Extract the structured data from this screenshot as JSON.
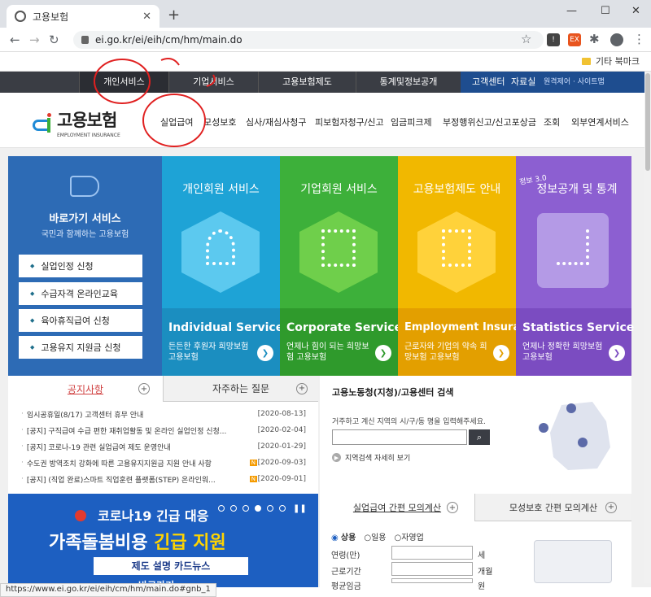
{
  "browser": {
    "tab_title": "고용보험",
    "url": "ei.go.kr/ei/eih/cm/hm/main.do",
    "bookmark_folder": "기타 북마크",
    "status_url": "https://www.ei.go.kr/ei/eih/cm/hm/main.do#gnb_1"
  },
  "gnb": {
    "items": [
      "개인서비스",
      "기업서비스",
      "고용보험제도",
      "통계및정보공개"
    ],
    "center": "고객센터",
    "data": "자료실",
    "links": "원격제어 · 사이트맵"
  },
  "logo": {
    "ko": "고용보험",
    "en": "EMPLOYMENT INSURANCE"
  },
  "lnb": {
    "items": [
      "실업급여",
      "모성보호",
      "심사/재심사청구",
      "피보험자청구/신고",
      "임금피크제",
      "부정행위신고/신고포상금",
      "조회",
      "외부연계서비스"
    ]
  },
  "quick": {
    "title": "바로가기 서비스",
    "subtitle": "국민과 함께하는 고용보험",
    "buttons": [
      "실업인정 신청",
      "수급자격 온라인교육",
      "육아휴직급여 신청",
      "고용유지 지원금 신청"
    ]
  },
  "services": [
    {
      "title": "개인회원 서비스",
      "en": "Individual Service",
      "desc": "든든한 후원자 희망보험 고용보험",
      "color": "#1ea3d6",
      "band": "#1b8ec0"
    },
    {
      "title": "기업회원 서비스",
      "en": "Corporate Service",
      "desc": "언제나 힘이 되는 희망보험 고용보험",
      "color": "#3db03a",
      "band": "#2f9a2c"
    },
    {
      "title": "고용보험제도 안내",
      "en": "Employment Insurance",
      "desc": "근로자와 기업의 약속 희망보험 고용보험",
      "color": "#f1b800",
      "band": "#e39f00"
    },
    {
      "title": "정보공개 및 통계",
      "title_prefix": "정보 3.0",
      "en": "Statistics Service",
      "desc": "언제나 정확한 희망보험 고용보험",
      "color": "#8c5fd1",
      "band": "#7b4cc1"
    }
  ],
  "notice": {
    "tabs": [
      "공지사항",
      "자주하는 질문"
    ],
    "items": [
      {
        "title": "임시공휴일(8/17) 고객센터 휴무 안내",
        "date": "[2020-08-13]",
        "new": false
      },
      {
        "title": "[공지] 구직급여 수급 편한 재취업활동 및 온라인 실업인정 신청...",
        "date": "[2020-02-04]",
        "new": false
      },
      {
        "title": "[공지] 코로나-19 관련 실업급여 제도 운영안내",
        "date": "[2020-01-29]",
        "new": false
      },
      {
        "title": "수도권 방역조치 강화에 따른 고용유지지원금 지원 안내 사항",
        "date": "[2020-09-03]",
        "new": true
      },
      {
        "title": "[공지] (직업 완료)스마트 직업훈련 플랫폼(STEP) 온라인워...",
        "date": "[2020-09-01]",
        "new": true
      }
    ],
    "new_badge": "N"
  },
  "center_search": {
    "title": "고용노동청(지청)/고용센터 검색",
    "desc": "거주하고 계신 지역의 시/구/동 명을 입력해주세요.",
    "input_value": "",
    "detail_link": "지역검색 자세히 보기"
  },
  "banner": {
    "line1": "코로나19 긴급 대응",
    "line2a": "가족돌봄비용 ",
    "line2b": "긴급 지원",
    "line3": "제도 설명 카드뉴스",
    "line4": "바로가기"
  },
  "calc": {
    "tabs": [
      "실업급여 간편 모의계산",
      "모성보호 간편 모의계산"
    ],
    "radios": [
      "상용",
      "일용",
      "자영업"
    ],
    "selected": "상용",
    "fields": [
      {
        "label": "연령(만)",
        "unit": "세"
      },
      {
        "label": "근로기간",
        "unit": "개월"
      },
      {
        "label": "평균임금",
        "unit": "원"
      }
    ]
  }
}
